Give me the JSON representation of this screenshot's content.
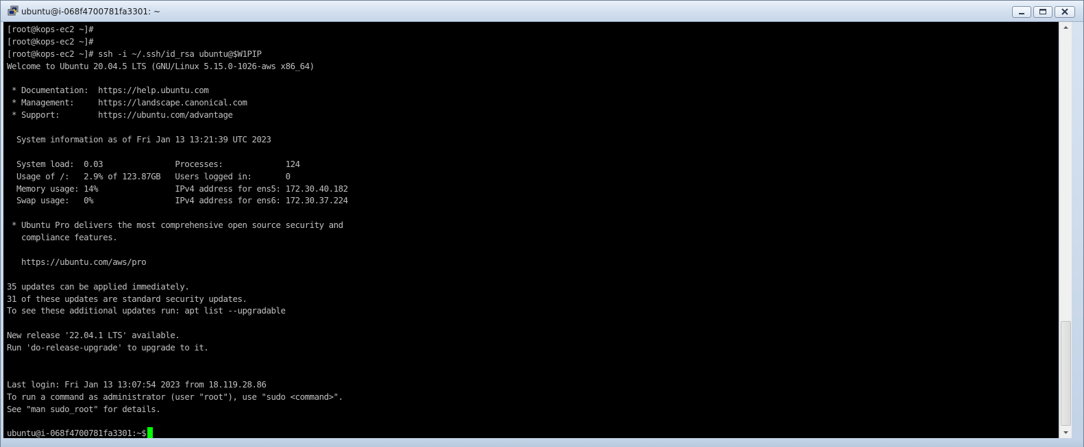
{
  "window": {
    "title": "ubuntu@i-068f4700781fa3301: ~",
    "icon": "putty-terminal-icon",
    "controls": [
      "minimize",
      "maximize",
      "close"
    ]
  },
  "terminal": {
    "background": "#000000",
    "foreground": "#c0c0c0",
    "cursor_color": "#00ff00",
    "lines": [
      "[root@kops-ec2 ~]#",
      "[root@kops-ec2 ~]#",
      "[root@kops-ec2 ~]# ssh -i ~/.ssh/id_rsa ubuntu@$W1PIP",
      "Welcome to Ubuntu 20.04.5 LTS (GNU/Linux 5.15.0-1026-aws x86_64)",
      "",
      " * Documentation:  https://help.ubuntu.com",
      " * Management:     https://landscape.canonical.com",
      " * Support:        https://ubuntu.com/advantage",
      "",
      "  System information as of Fri Jan 13 13:21:39 UTC 2023",
      "",
      "  System load:  0.03               Processes:             124",
      "  Usage of /:   2.9% of 123.87GB   Users logged in:       0",
      "  Memory usage: 14%                IPv4 address for ens5: 172.30.40.182",
      "  Swap usage:   0%                 IPv4 address for ens6: 172.30.37.224",
      "",
      " * Ubuntu Pro delivers the most comprehensive open source security and",
      "   compliance features.",
      "",
      "   https://ubuntu.com/aws/pro",
      "",
      "35 updates can be applied immediately.",
      "31 of these updates are standard security updates.",
      "To see these additional updates run: apt list --upgradable",
      "",
      "New release '22.04.1 LTS' available.",
      "Run 'do-release-upgrade' to upgrade to it.",
      "",
      "",
      "Last login: Fri Jan 13 13:07:54 2023 from 18.119.28.86",
      "To run a command as administrator (user \"root\"), use \"sudo <command>\".",
      "See \"man sudo_root\" for details.",
      ""
    ],
    "prompt": "ubuntu@i-068f4700781fa3301:~$ "
  },
  "scrollbar": {
    "position": 0.75
  }
}
